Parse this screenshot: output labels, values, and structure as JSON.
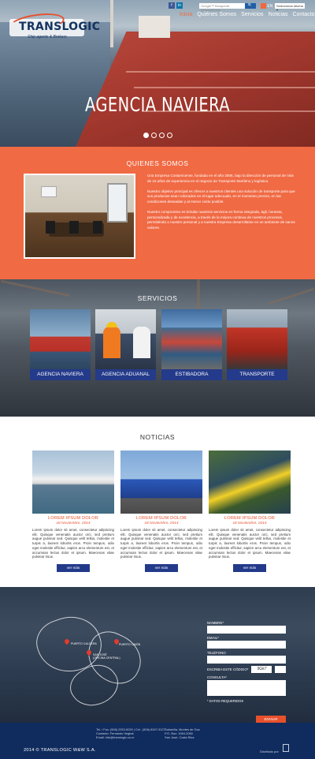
{
  "header": {
    "logo_text": "TRANSLOGIC",
    "logo_tagline": "Ship agents & Brokers",
    "nav": [
      "Inicio",
      "Quiénes Somos",
      "Servicios",
      "Noticias",
      "Contacto"
    ],
    "search_placeholder": "Google™ Búsqueda personalizada",
    "search_button": "🔍",
    "lang_label": "EN",
    "lang_select": "Seleccionar idioma ▾"
  },
  "hero": {
    "title": "AGENCIA NAVIERA",
    "slides": 4,
    "active_slide": 1
  },
  "quienes": {
    "heading": "QUIENES SOMOS",
    "paragraphs": [
      "Una Empresa Costarricense, fundada en el año 2006, bajo la dirección de personal de más de 15 años de experiencia en el negocio de Transporte Marítimo y logística.",
      "Nuestro objetivo principal es ofrecer a nuestros clientes una solución de transporte para que sus productos sean colocados en el lugar adecuado, en el momento preciso, en las condiciones deseadas y al menor costo posible.",
      "Nuestro compromiso es brindar nuestros servicios en forma integrada, ágil, honesta, personalizada y de excelencia, a través de la mejora continua de nuestros procesos, permitiéndo a nuestro personal y a nuestra Empresa desarrollarse en un ambiente de sanos valores."
    ]
  },
  "servicios": {
    "heading": "SERVICIOS",
    "items": [
      "AGENCIA NAVIERA",
      "AGENCIA ADUANAL",
      "ESTIBADORA",
      "TRANSPORTE"
    ]
  },
  "noticias": {
    "heading": "NOTICIAS",
    "items": [
      {
        "title": "LOREM IPSUM DOLOR",
        "date": "18 Noviembre, 2014",
        "body": "Lorem ipsum dolor sit amet, consectetur adipiscing elit. Quisque venenatis auctor orci, sed pretium augue pulvinar sed. Quisque velit tellus, molestie et turpis a, laoreet lobortis eros. Proin tempus, odio eget molestie efficitur, sapien arcu elementum est, et accumsan lectus dolor et ipsum. Maecenas vitae pulvinar risus.",
        "button": "ver más"
      },
      {
        "title": "LOREM IPSUM DOLOR",
        "date": "18 Noviembre, 2014",
        "body": "Lorem ipsum dolor sit amet, consectetur adipiscing elit. Quisque venenatis auctor orci, sed pretium augue pulvinar sed. Quisque velit tellus, molestie et turpis a, laoreet lobortis eros. Proin tempus, odio eget molestie efficitur, sapien arcu elementum est, et accumsan lectus dolor et ipsum. Maecenas vitae pulvinar risus.",
        "button": "ver más"
      },
      {
        "title": "LOREM IPSUM DOLOR",
        "date": "18 Noviembre, 2014",
        "body": "Lorem ipsum dolor sit amet, consectetur adipiscing elit. Quisque venenatis auctor orci, sed pretium augue pulvinar sed. Quisque velit tellus, molestie et turpis a, laoreet lobortis eros. Proin tempus, odio eget molestie efficitur, sapien arcu elementum est, et accumsan lectus dolor et ipsum. Maecenas vitae pulvinar risus.",
        "button": "ver más"
      }
    ]
  },
  "contacto": {
    "map_labels": {
      "caldera": "PUERTO CALDERA",
      "limon": "PUERTO LIMÓN",
      "sanjose": "SAN JOSÉ\n(OFICINA CENTRAL)"
    },
    "labels": {
      "nombre": "NOMBRE*",
      "email": "EMAIL*",
      "telefono": "TELÉFONO",
      "codigo": "ESCRIBA ESTE CÓDIGO*",
      "consulta": "CONSULTA*",
      "required": "* DATOS REQUERIDOS"
    },
    "captcha_text": "9Gk7",
    "send_button": "ENVIAR"
  },
  "footer": {
    "copyright": "2014 © TRANSLOGIC W&W S.A.",
    "contact_lines": [
      "Tel. / Fax: (506) 2253-9029 | Cel.: (506) 8347-9127",
      "Contacto: Fernando Vegbat",
      "Email: info@translogic.co.cr"
    ],
    "address_lines": [
      "Sabanilla, Montes de Oca",
      "P.O. Box: 1084-2050",
      "San José, Costa Rica"
    ],
    "design_label": "Diseñado por"
  },
  "colors": {
    "accent": "#f06a44",
    "brand_blue": "#243a8a",
    "footer": "#102c5e"
  }
}
